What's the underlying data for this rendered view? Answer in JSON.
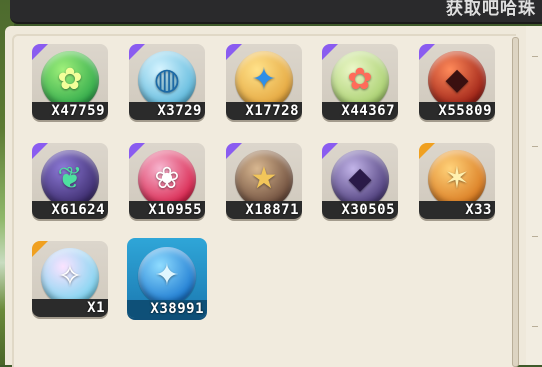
{
  "header": {
    "title": "获取吧哈珠"
  },
  "items": [
    {
      "count": "X47759",
      "rarity_color": "#8a5cf0",
      "icon": "green-flower-orb-icon",
      "orb_colors": [
        "#9ff07a",
        "#2ea84a"
      ],
      "glyph": "✿",
      "glyph_color": "#f4ff9a"
    },
    {
      "count": "X3729",
      "rarity_color": "#8a5cf0",
      "icon": "blue-cage-orb-icon",
      "orb_colors": [
        "#d6f4ff",
        "#5cb8dc"
      ],
      "glyph": "◍",
      "glyph_color": "#1c6aa6"
    },
    {
      "count": "X17728",
      "rarity_color": "#8a5cf0",
      "icon": "blue-star-orb-icon",
      "orb_colors": [
        "#ffe28a",
        "#e3a43c"
      ],
      "glyph": "✦",
      "glyph_color": "#2f8fe8"
    },
    {
      "count": "X44367",
      "rarity_color": "#8a5cf0",
      "icon": "pink-flower-orb-icon",
      "orb_colors": [
        "#ecf7c9",
        "#a7cf6d"
      ],
      "glyph": "✿",
      "glyph_color": "#ff6b5a"
    },
    {
      "count": "X55809",
      "rarity_color": "#8a5cf0",
      "icon": "red-crystal-orb-icon",
      "orb_colors": [
        "#ff8a5a",
        "#9a1e14"
      ],
      "glyph": "◆",
      "glyph_color": "#3a1010"
    },
    {
      "count": "X61624",
      "rarity_color": "#8a5cf0",
      "icon": "purple-leaf-orb-icon",
      "orb_colors": [
        "#8d7ad8",
        "#3a2a6a"
      ],
      "glyph": "❦",
      "glyph_color": "#4ee0a0"
    },
    {
      "count": "X10955",
      "rarity_color": "#8a5cf0",
      "icon": "red-ring-flower-orb-icon",
      "orb_colors": [
        "#f7b6d0",
        "#d8204a"
      ],
      "glyph": "❀",
      "glyph_color": "#ffffff"
    },
    {
      "count": "X18871",
      "rarity_color": "#8a5cf0",
      "icon": "bronze-star-orb-icon",
      "orb_colors": [
        "#d8b790",
        "#6a4a3a"
      ],
      "glyph": "★",
      "glyph_color": "#f2c65a"
    },
    {
      "count": "X30505",
      "rarity_color": "#8a5cf0",
      "icon": "purple-gem-orb-icon",
      "orb_colors": [
        "#c2b4e8",
        "#4a3a78"
      ],
      "glyph": "◆",
      "glyph_color": "#2a1a48"
    },
    {
      "count": "X33",
      "rarity_color": "#f0a020",
      "icon": "orange-star-orb-icon",
      "orb_colors": [
        "#ffd27a",
        "#d8781e"
      ],
      "glyph": "✶",
      "glyph_color": "#fff1b0"
    },
    {
      "count": "X1",
      "rarity_color": "#f0a020",
      "icon": "rainbow-crystal-orb-icon",
      "orb_colors": [
        "#fbe3ff",
        "#7ad4f0"
      ],
      "glyph": "✧",
      "glyph_color": "#ffffff"
    },
    {
      "count": "X38991",
      "rarity_color": "",
      "icon": "blue-star-orb-icon",
      "orb_colors": [
        "#8fdcff",
        "#1a78d0"
      ],
      "glyph": "✦",
      "glyph_color": "#dff6ff",
      "selected": true
    }
  ]
}
